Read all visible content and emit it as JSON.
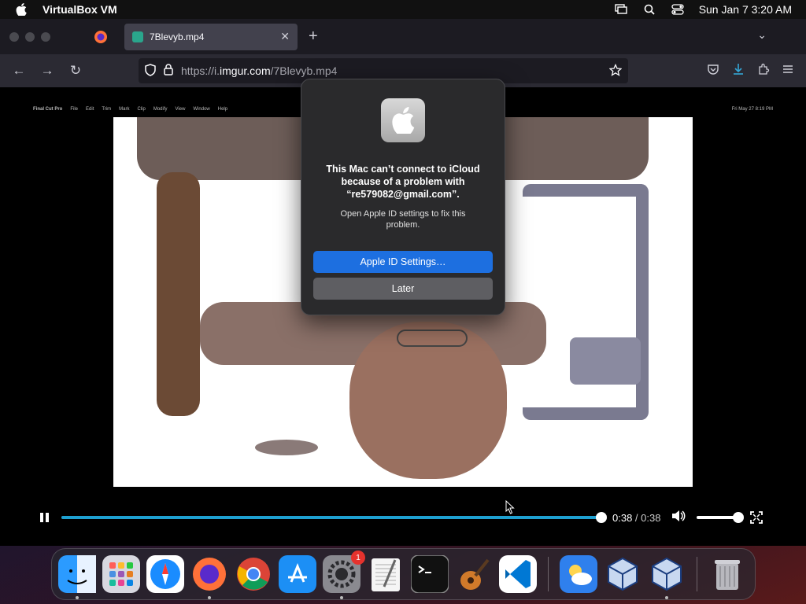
{
  "menubar": {
    "app_name": "VirtualBox VM",
    "clock": "Sun Jan 7  3:20 AM"
  },
  "browser": {
    "tab_title": "7Blevyb.mp4",
    "url_prefix": "https://i.",
    "url_domain": "imgur.com",
    "url_path": "/7Blevyb.mp4"
  },
  "video": {
    "vm_menu": [
      "Final Cut Pro",
      "File",
      "Edit",
      "Trim",
      "Mark",
      "Clip",
      "Modify",
      "View",
      "Window",
      "Help"
    ],
    "vm_clock": "Fri May 27  8:19 PM",
    "current_time": "0:38",
    "separator": " / ",
    "duration": "0:38",
    "progress_fraction": 1.0,
    "volume_fraction": 1.0
  },
  "dialog": {
    "message": "This Mac can’t connect to iCloud because of a problem with “re579082@gmail.com”.",
    "subtext": "Open Apple ID settings to fix this problem.",
    "primary_button": "Apple ID Settings…",
    "secondary_button": "Later"
  },
  "dock": {
    "items": [
      {
        "name": "finder",
        "color": "#1e90ff",
        "running": true
      },
      {
        "name": "launchpad",
        "color": "#d0d0d8",
        "running": false
      },
      {
        "name": "safari",
        "color": "#1a8cff",
        "running": false
      },
      {
        "name": "firefox",
        "color": "#ff7139",
        "running": true
      },
      {
        "name": "chrome",
        "color": "#ffffff",
        "running": false
      },
      {
        "name": "app-store",
        "color": "#1c8ff5",
        "running": false
      },
      {
        "name": "system-settings",
        "color": "#8a8a90",
        "running": true,
        "badge": "1"
      },
      {
        "name": "textedit",
        "color": "#f5f5f5",
        "running": false
      },
      {
        "name": "terminal",
        "color": "#111111",
        "running": false
      },
      {
        "name": "garageband",
        "color": "#3a2a20",
        "running": false
      },
      {
        "name": "vscode",
        "color": "#ffffff",
        "running": false
      }
    ],
    "recent": [
      {
        "name": "weather",
        "color": "#2f80ed",
        "running": false
      },
      {
        "name": "virtualbox",
        "color": "#c8d8f0",
        "running": false
      },
      {
        "name": "virtualbox-vm",
        "color": "#c8d8f0",
        "running": true
      }
    ],
    "trash": {
      "name": "trash",
      "color": "#9a9aa0"
    }
  }
}
